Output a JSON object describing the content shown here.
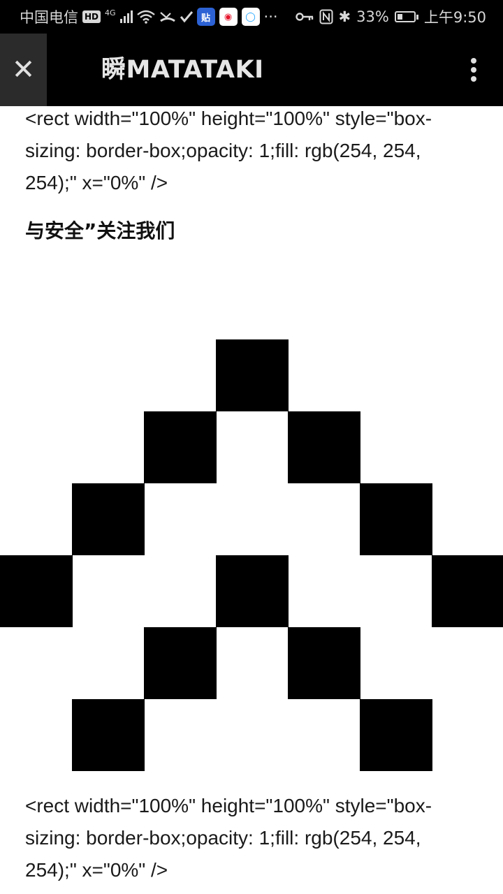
{
  "status_bar": {
    "carrier": "中国电信",
    "hd": "HD",
    "network": "4G",
    "bluetooth": "✱",
    "battery_percent": "33%",
    "battery_level": 0.33,
    "time": "上午9:50",
    "app_icons": [
      "tieba-icon",
      "weibo-icon",
      "qq-browser-icon"
    ],
    "more": "···"
  },
  "header": {
    "close_label": "✕",
    "title": "瞬MATATAKI",
    "more_icon": "vertical-dots-icon"
  },
  "content": {
    "code_top": "<rect width=\"100%\" height=\"100%\" style=\"box-sizing: border-box;opacity: 1;fill: rgb(254, 254, 254);\" x=\"0%\" />",
    "heading": "与安全”关注我们",
    "code_bottom": "<rect width=\"100%\" height=\"100%\" style=\"box-sizing: border-box;opacity: 1;fill: rgb(254, 254, 254);\" x=\"0%\" />"
  },
  "colors": {
    "bar_bg": "#000000",
    "page_bg": "#ffffff",
    "pattern": "#000000"
  }
}
